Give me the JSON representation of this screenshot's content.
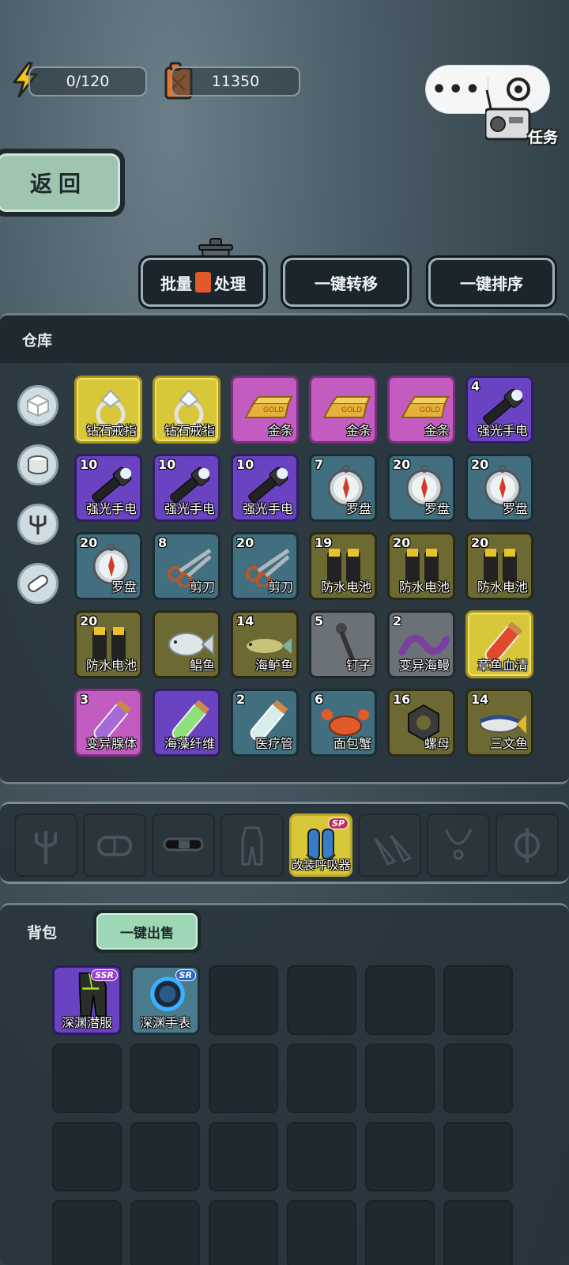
{
  "status": {
    "energy": "0/120",
    "fuel": "11350"
  },
  "mini_capsule": {
    "more_label": "•••"
  },
  "task_label": "任务",
  "back_label": "返回",
  "actions": {
    "batch_left": "批量",
    "batch_right": "处理",
    "transfer": "一键转移",
    "sort": "一键排序"
  },
  "warehouse": {
    "title": "仓库",
    "categories": [
      "cube-icon",
      "can-icon",
      "trident-icon",
      "pill-icon"
    ],
    "items": [
      {
        "qty": "",
        "name": "钻石戒指",
        "rarity": "yellow",
        "icon": "ring"
      },
      {
        "qty": "",
        "name": "钻石戒指",
        "rarity": "yellow",
        "icon": "ring"
      },
      {
        "qty": "",
        "name": "金条",
        "rarity": "pink",
        "icon": "gold"
      },
      {
        "qty": "",
        "name": "金条",
        "rarity": "pink",
        "icon": "gold"
      },
      {
        "qty": "",
        "name": "金条",
        "rarity": "pink",
        "icon": "gold"
      },
      {
        "qty": "4",
        "name": "强光手电",
        "rarity": "purple",
        "icon": "flashlight"
      },
      {
        "qty": "10",
        "name": "强光手电",
        "rarity": "purple",
        "icon": "flashlight"
      },
      {
        "qty": "10",
        "name": "强光手电",
        "rarity": "purple",
        "icon": "flashlight"
      },
      {
        "qty": "10",
        "name": "强光手电",
        "rarity": "purple",
        "icon": "flashlight"
      },
      {
        "qty": "7",
        "name": "罗盘",
        "rarity": "teal",
        "icon": "compass"
      },
      {
        "qty": "20",
        "name": "罗盘",
        "rarity": "teal",
        "icon": "compass"
      },
      {
        "qty": "20",
        "name": "罗盘",
        "rarity": "teal",
        "icon": "compass"
      },
      {
        "qty": "20",
        "name": "罗盘",
        "rarity": "teal",
        "icon": "compass"
      },
      {
        "qty": "8",
        "name": "剪刀",
        "rarity": "teal",
        "icon": "scissors"
      },
      {
        "qty": "20",
        "name": "剪刀",
        "rarity": "teal",
        "icon": "scissors"
      },
      {
        "qty": "19",
        "name": "防水电池",
        "rarity": "olive",
        "icon": "battery"
      },
      {
        "qty": "20",
        "name": "防水电池",
        "rarity": "olive",
        "icon": "battery"
      },
      {
        "qty": "20",
        "name": "防水电池",
        "rarity": "olive",
        "icon": "battery"
      },
      {
        "qty": "20",
        "name": "防水电池",
        "rarity": "olive",
        "icon": "battery"
      },
      {
        "qty": "",
        "name": "鲳鱼",
        "rarity": "olive",
        "icon": "pomfret"
      },
      {
        "qty": "14",
        "name": "海鲈鱼",
        "rarity": "olive",
        "icon": "bass"
      },
      {
        "qty": "5",
        "name": "钉子",
        "rarity": "gray",
        "icon": "nail"
      },
      {
        "qty": "2",
        "name": "变异海鳗",
        "rarity": "gray",
        "icon": "eel"
      },
      {
        "qty": "",
        "name": "章鱼血清",
        "rarity": "yellow",
        "icon": "vial-red"
      },
      {
        "qty": "3",
        "name": "变异腺体",
        "rarity": "pink",
        "icon": "vial-purple"
      },
      {
        "qty": "",
        "name": "海藻纤维",
        "rarity": "purple",
        "icon": "vial-green"
      },
      {
        "qty": "2",
        "name": "医疗管",
        "rarity": "teal",
        "icon": "vial-clear"
      },
      {
        "qty": "6",
        "name": "面包蟹",
        "rarity": "teal",
        "icon": "crab"
      },
      {
        "qty": "16",
        "name": "螺母",
        "rarity": "olive",
        "icon": "nut"
      },
      {
        "qty": "14",
        "name": "三文鱼",
        "rarity": "olive",
        "icon": "tuna"
      }
    ]
  },
  "equipment": [
    {
      "icon": "trident-icon",
      "name": ""
    },
    {
      "icon": "mask-icon",
      "name": ""
    },
    {
      "icon": "belt-icon",
      "name": ""
    },
    {
      "icon": "suit-icon",
      "name": ""
    },
    {
      "icon": "tank-icon",
      "name": "改装呼吸器",
      "badge": "SP"
    },
    {
      "icon": "fins-icon",
      "name": ""
    },
    {
      "icon": "necklace-icon",
      "name": ""
    },
    {
      "icon": "phi-icon",
      "name": ""
    }
  ],
  "backpack": {
    "title": "背包",
    "sell_label": "一键出售",
    "items": [
      {
        "name": "深渊潜服",
        "badge": "SSR"
      },
      {
        "name": "深渊手表",
        "badge": "SR"
      }
    ],
    "empty_slots": 22
  }
}
